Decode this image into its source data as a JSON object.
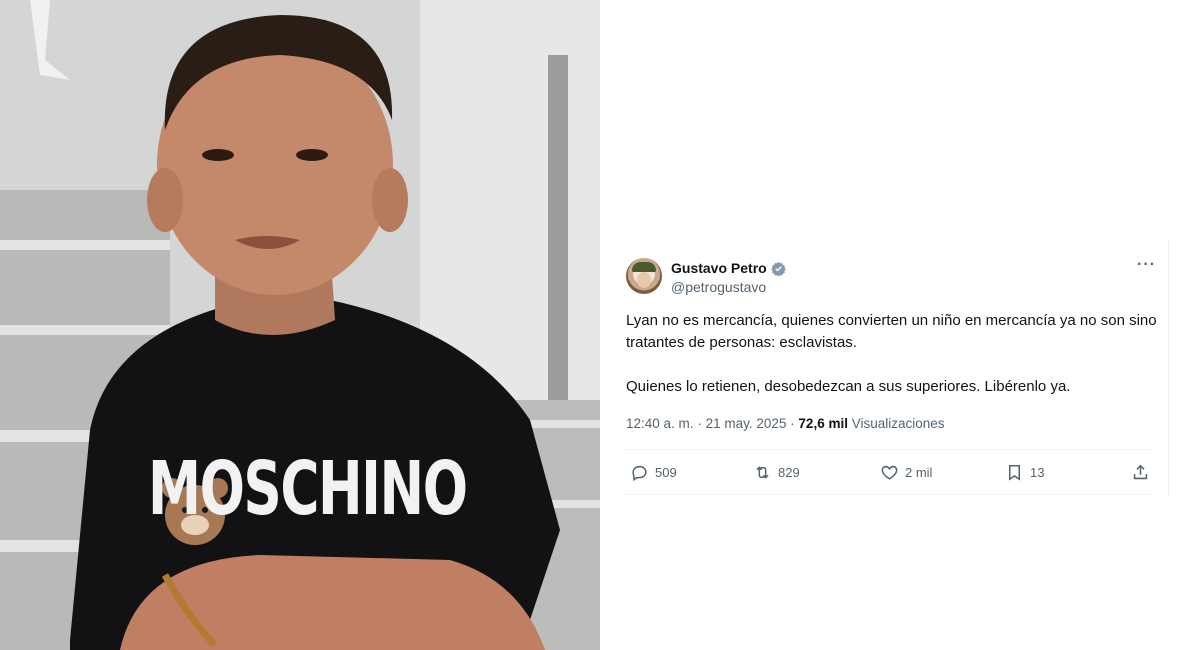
{
  "photo": {
    "shirt_text": "MOSCHINO"
  },
  "tweet": {
    "author_name": "Gustavo Petro",
    "author_handle": "@petrogustavo",
    "verified": true,
    "more_label": "···",
    "paragraphs": [
      "Lyan no es mercancía, quienes convierten un niño en mercancía ya no son sino tratantes de personas: esclavistas.",
      "Quienes lo retienen, desobedezcan a sus superiores. Libérenlo ya."
    ],
    "time": "12:40 a. m.",
    "separator": "·",
    "date": "21 may. 2025",
    "views_count": "72,6 mil",
    "views_label": "Visualizaciones",
    "actions": {
      "replies": "509",
      "reposts": "829",
      "likes": "2 mil",
      "bookmarks": "13"
    },
    "icons": {
      "reply": "reply-icon",
      "repost": "repost-icon",
      "like": "heart-icon",
      "bookmark": "bookmark-icon",
      "share": "share-icon",
      "verified": "verified-badge-icon"
    },
    "colors": {
      "text": "#0f1419",
      "secondary": "#536471",
      "verified_badge": "#829aab"
    }
  }
}
